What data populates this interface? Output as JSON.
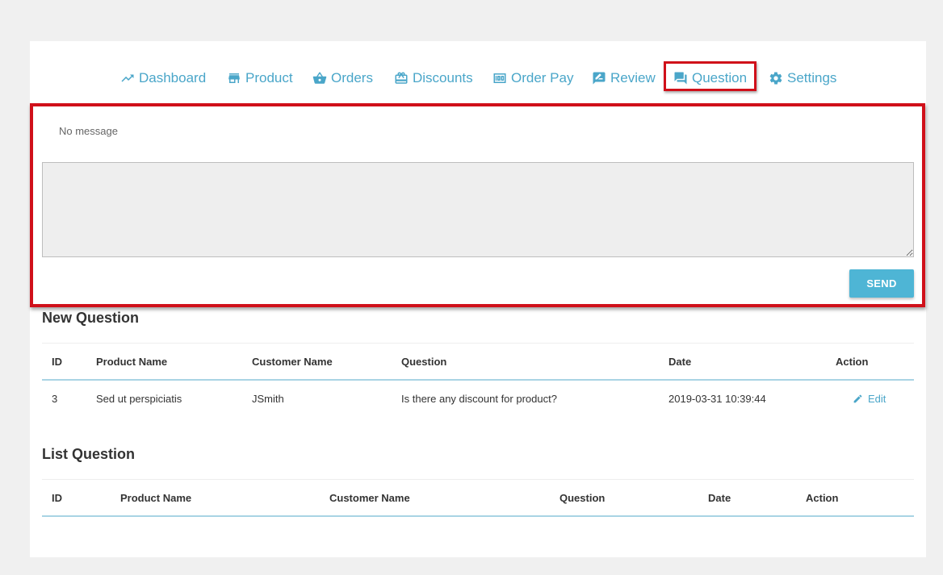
{
  "nav": {
    "items": [
      {
        "label": "Dashboard",
        "icon": "trending-up-icon"
      },
      {
        "label": "Product",
        "icon": "store-icon"
      },
      {
        "label": "Orders",
        "icon": "basket-icon"
      },
      {
        "label": "Discounts",
        "icon": "gift-card-icon"
      },
      {
        "label": "Order Pay",
        "icon": "money-icon"
      },
      {
        "label": "Review",
        "icon": "rate-review-icon"
      },
      {
        "label": "Question",
        "icon": "forum-icon",
        "active": true
      },
      {
        "label": "Settings",
        "icon": "gear-icon"
      }
    ]
  },
  "message": {
    "status": "No message",
    "textarea_value": "",
    "send_label": "SEND"
  },
  "new_question": {
    "title": "New Question",
    "columns": [
      "ID",
      "Product Name",
      "Customer Name",
      "Question",
      "Date",
      "Action"
    ],
    "rows": [
      {
        "id": "3",
        "product_name": "Sed ut perspiciatis",
        "customer_name": "JSmith",
        "question": "Is there any discount for product?",
        "date": "2019-03-31 10:39:44",
        "action": "Edit"
      }
    ]
  },
  "list_question": {
    "title": "List Question",
    "columns": [
      "ID",
      "Product Name",
      "Customer Name",
      "Question",
      "Date",
      "Action"
    ],
    "rows": []
  },
  "colors": {
    "accent": "#4aa6c9",
    "button": "#4eb5d5",
    "highlight": "#d0101a",
    "table_header_line": "#a9d4e4"
  }
}
